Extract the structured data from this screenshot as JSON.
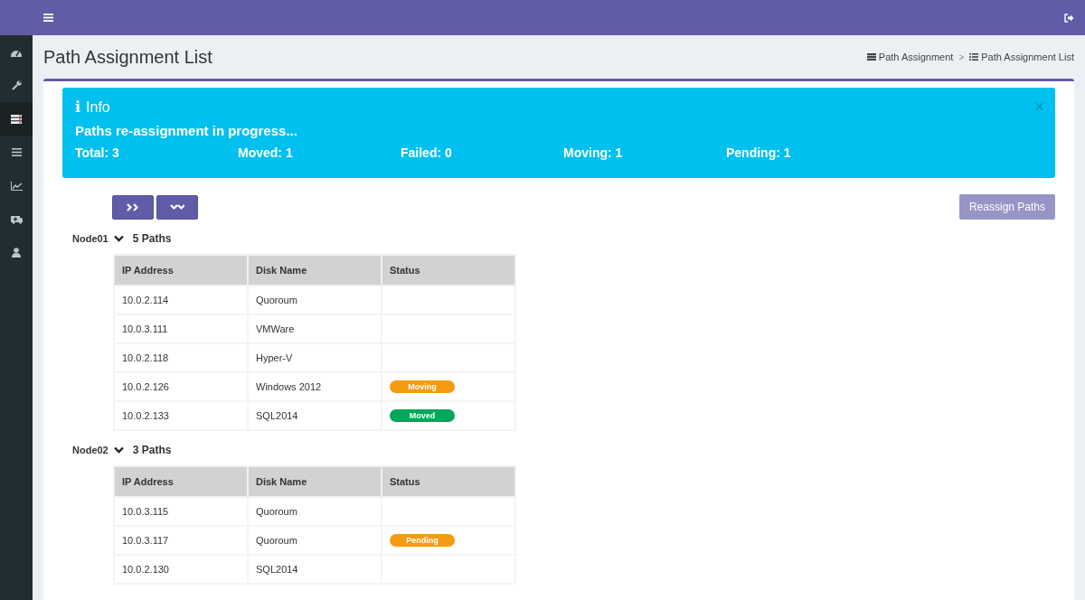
{
  "sidebar": {
    "items": [
      {
        "kind": "dashboard",
        "selected": false
      },
      {
        "kind": "wrench",
        "selected": false
      },
      {
        "kind": "server",
        "selected": true
      },
      {
        "kind": "list",
        "selected": false
      },
      {
        "kind": "chart",
        "selected": false
      },
      {
        "kind": "medkit",
        "selected": false
      },
      {
        "kind": "user",
        "selected": false
      }
    ]
  },
  "page": {
    "title": "Path Assignment List",
    "breadcrumb": [
      {
        "kind": "server",
        "label": "Path Assignment"
      },
      {
        "kind": "list",
        "label": "Path Assignment List"
      }
    ],
    "breadcrumb_separator": ">"
  },
  "alert": {
    "title": "Info",
    "icon": "i",
    "message": "Paths re-assignment in progress...",
    "close": "×",
    "stats": [
      "Total: 3",
      "Moved: 1",
      "Failed: 0",
      "Moving: 1",
      "Pending: 1"
    ]
  },
  "toolbar": {
    "reassign_button": "Reassign Paths",
    "reassign_disabled": true
  },
  "nodes": [
    {
      "name": "Node01",
      "expanded": true,
      "count": "5 Paths",
      "columns": [
        "IP Address",
        "Disk Name",
        "Status"
      ],
      "rows": [
        {
          "ip": "10.0.2.114",
          "disk": "Quoroum"
        },
        {
          "ip": "10.0.3.111",
          "disk": "VMWare"
        },
        {
          "ip": "10.0.2.118",
          "disk": "Hyper-V"
        },
        {
          "ip": "10.0.2.126",
          "disk": "Windows 2012",
          "status": {
            "label": "Moving",
            "color": "#f39c12"
          }
        },
        {
          "ip": "10.0.2.133",
          "disk": "SQL2014",
          "status": {
            "label": "Moved",
            "color": "#00a65a"
          }
        }
      ]
    },
    {
      "name": "Node02",
      "expanded": true,
      "count": "3 Paths",
      "columns": [
        "IP Address",
        "Disk Name",
        "Status"
      ],
      "rows": [
        {
          "ip": "10.0.3.115",
          "disk": "Quoroum"
        },
        {
          "ip": "10.0.3.117",
          "disk": "Quoroum",
          "status": {
            "label": "Pending",
            "color": "#f39c12"
          }
        },
        {
          "ip": "10.0.2.130",
          "disk": "SQL2014"
        }
      ]
    }
  ]
}
